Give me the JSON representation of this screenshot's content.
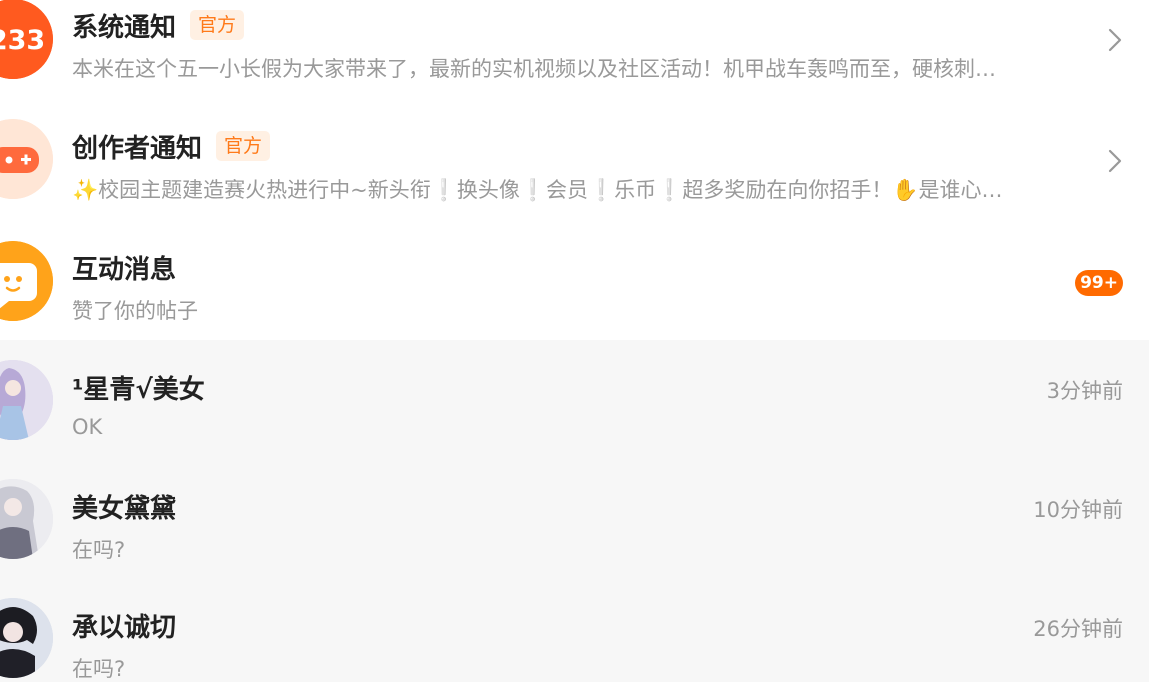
{
  "messages": {
    "system": {
      "title": "系统通知",
      "badge": "官方",
      "avatar_text": "233",
      "preview": "本米在这个五一小长假为大家带来了，最新的实机视频以及社区活动！机甲战车轰鸣而至，硬核刺…"
    },
    "creator": {
      "title": "创作者通知",
      "badge": "官方",
      "preview": "✨校园主题建造赛火热进行中~新头衔❕换头像❕会员❕乐币❕超多奖励在向你招手！✋是谁心…"
    },
    "interaction": {
      "title": "互动消息",
      "preview": "赞了你的帖子",
      "count": "99+"
    },
    "chats": [
      {
        "name": "¹星青√美女",
        "preview": "OK",
        "time": "3分钟前"
      },
      {
        "name": "美女黛黛",
        "preview": "在吗?",
        "time": "10分钟前"
      },
      {
        "name": "承以诚切",
        "preview": "在吗?",
        "time": "26分钟前"
      }
    ]
  },
  "colors": {
    "accent": "#ff6a00",
    "official_badge_bg": "#fff0e3",
    "official_badge_text": "#ff7a1a",
    "chat_row_bg": "#f7f7f7"
  },
  "icons": {
    "system": "233-logo-icon",
    "creator": "gamepad-icon",
    "interaction": "chat-face-icon",
    "chevron": "chevron-right-icon"
  }
}
